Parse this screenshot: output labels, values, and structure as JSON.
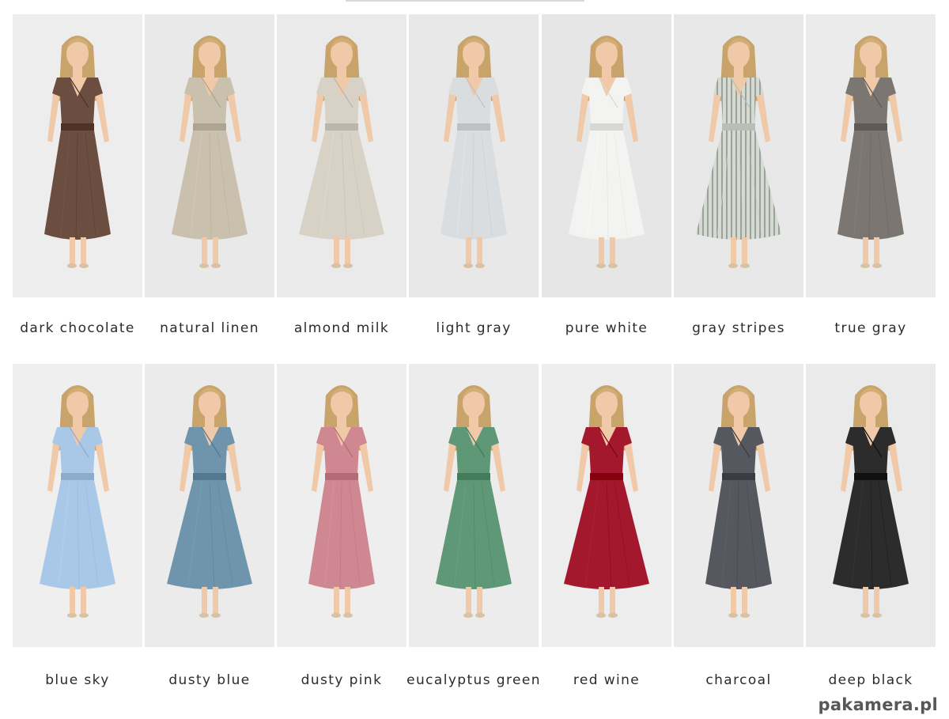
{
  "swatches": [
    {
      "name": "dark chocolate",
      "color": "#6b4e40",
      "bg": "#ededed"
    },
    {
      "name": "natural linen",
      "color": "#c9c0ad",
      "bg": "#e9e9e9"
    },
    {
      "name": "almond milk",
      "color": "#d8d1c6",
      "bg": "#eaeaea"
    },
    {
      "name": "light gray",
      "color": "#d9dde0",
      "bg": "#e8e8e8"
    },
    {
      "name": "pure white",
      "color": "#f3f3f2",
      "bg": "#e6e6e6"
    },
    {
      "name": "gray stripes",
      "color": "#d7dad3",
      "bg": "#e8e8e8"
    },
    {
      "name": "true gray",
      "color": "#7b7671",
      "bg": "#ebebeb"
    },
    {
      "name": "blue sky",
      "color": "#a9c8e8",
      "bg": "#efefef"
    },
    {
      "name": "dusty blue",
      "color": "#6f95ad",
      "bg": "#ebebeb"
    },
    {
      "name": "dusty pink",
      "color": "#cf8791",
      "bg": "#eeeeee"
    },
    {
      "name": "eucalyptus green",
      "color": "#5e9876",
      "bg": "#ececec"
    },
    {
      "name": "red wine",
      "color": "#a3182c",
      "bg": "#ededed"
    },
    {
      "name": "charcoal",
      "color": "#55585f",
      "bg": "#ebebeb"
    },
    {
      "name": "deep black",
      "color": "#2c2c2c",
      "bg": "#eaeaea"
    }
  ],
  "watermark": "pakamera.pl",
  "colors": {
    "skin": "#efc9a8",
    "hair": "#c8a46a",
    "caption": "#2b2b2b"
  }
}
